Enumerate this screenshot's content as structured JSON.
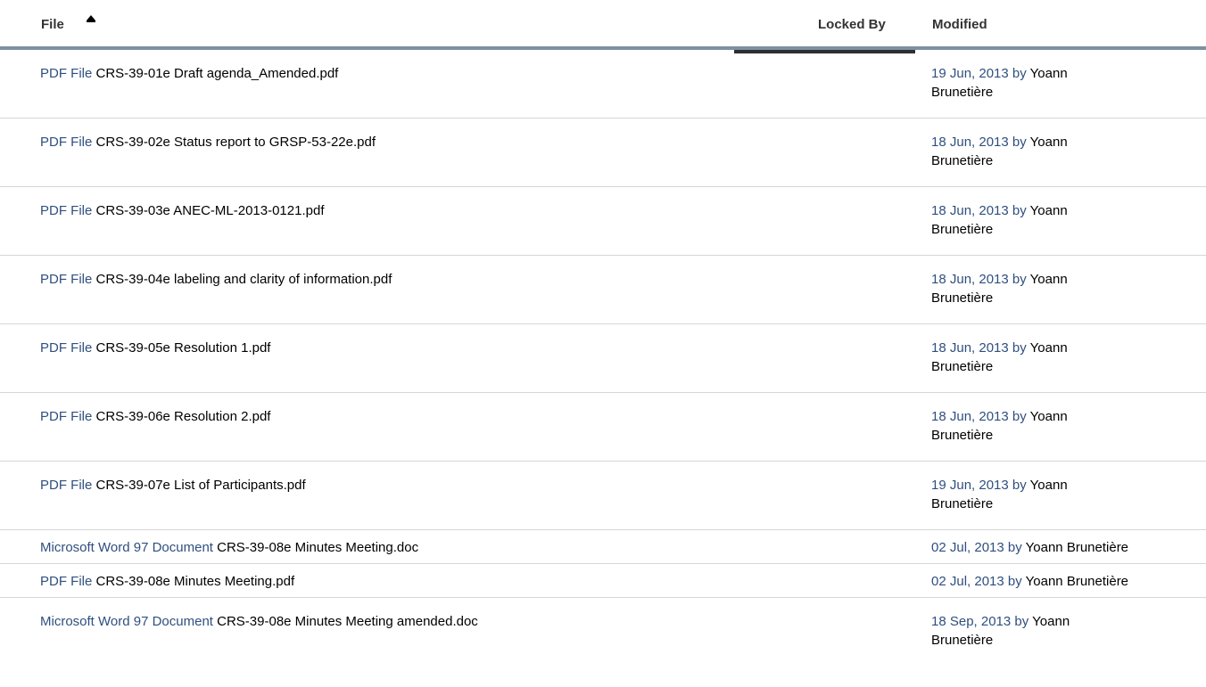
{
  "header": {
    "file_label": "File",
    "locked_by_label": "Locked By",
    "modified_label": "Modified",
    "sort_direction": "ascending"
  },
  "rows": [
    {
      "type": "PDF File",
      "name": "CRS-39-01e Draft agenda_Amended.pdf",
      "date": "19 Jun, 2013 by",
      "user": "Yoann Brunetière"
    },
    {
      "type": "PDF File",
      "name": "CRS-39-02e Status report to GRSP-53-22e.pdf",
      "date": "18 Jun, 2013 by",
      "user": "Yoann Brunetière"
    },
    {
      "type": "PDF File",
      "name": "CRS-39-03e ANEC-ML-2013-0121.pdf",
      "date": "18 Jun, 2013 by",
      "user": "Yoann Brunetière"
    },
    {
      "type": "PDF File",
      "name": "CRS-39-04e labeling and clarity of information.pdf",
      "date": "18 Jun, 2013 by",
      "user": "Yoann Brunetière"
    },
    {
      "type": "PDF File",
      "name": "CRS-39-05e Resolution 1.pdf",
      "date": "18 Jun, 2013 by",
      "user": "Yoann Brunetière"
    },
    {
      "type": "PDF File",
      "name": "CRS-39-06e Resolution 2.pdf",
      "date": "18 Jun, 2013 by",
      "user": "Yoann Brunetière"
    },
    {
      "type": "PDF File",
      "name": "CRS-39-07e List of Participants.pdf",
      "date": "19 Jun, 2013 by",
      "user": "Yoann Brunetière"
    },
    {
      "type": "Microsoft Word 97 Document",
      "name": "CRS-39-08e Minutes Meeting.doc",
      "date": "02 Jul, 2013 by",
      "user": "Yoann Brunetière"
    },
    {
      "type": "PDF File",
      "name": "CRS-39-08e Minutes Meeting.pdf",
      "date": "02 Jul, 2013 by",
      "user": "Yoann Brunetière"
    },
    {
      "type": "Microsoft Word 97 Document",
      "name": "CRS-39-08e Minutes Meeting amended.doc",
      "date": "18 Sep, 2013 by",
      "user": "Yoann Brunetière"
    }
  ],
  "colors": {
    "link": "#2f4f7f",
    "header_rule": "#7f8fa4",
    "active_column": "#2e2e2e"
  }
}
